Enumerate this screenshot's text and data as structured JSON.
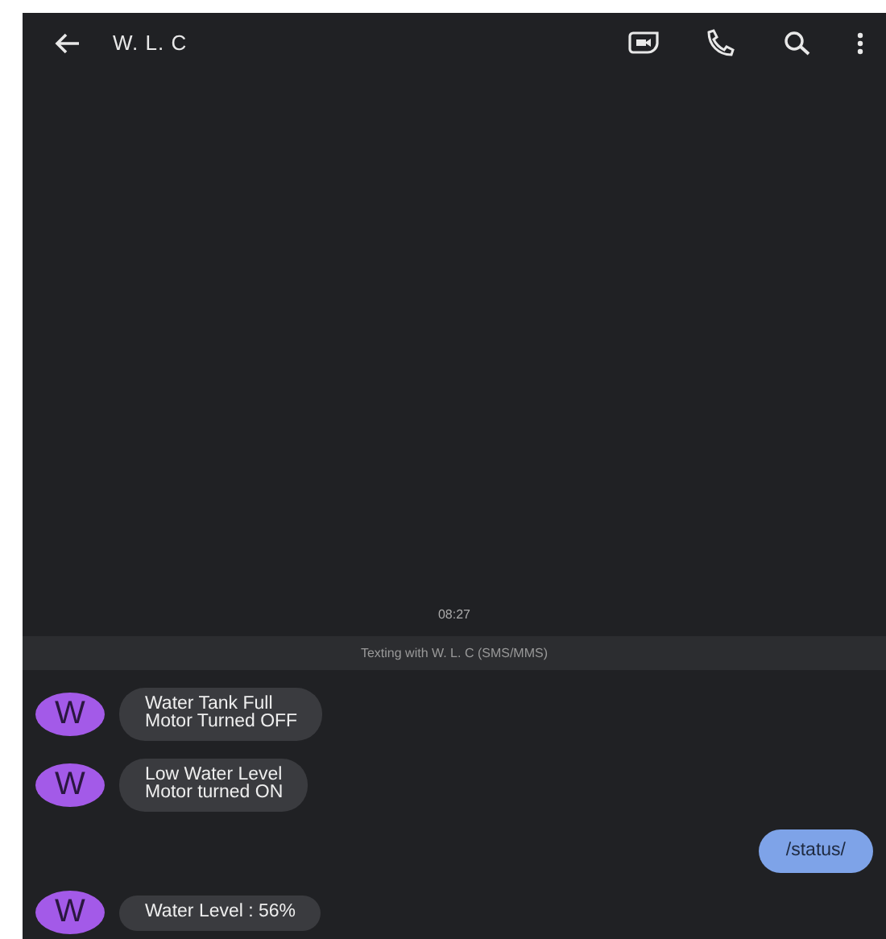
{
  "header": {
    "title": "W. L. C"
  },
  "timestamp": "08:27",
  "banner": "Texting with W. L. C (SMS/MMS)",
  "messages": [
    {
      "kind": "incoming",
      "avatar": "W",
      "text": "Water Tank Full\nMotor Turned OFF"
    },
    {
      "kind": "incoming",
      "avatar": "W",
      "text": "Low Water Level\nMotor turned ON"
    },
    {
      "kind": "outgoing",
      "text": "/status/"
    },
    {
      "kind": "incoming",
      "avatar": "W",
      "text": "Water Level : 56%"
    }
  ]
}
